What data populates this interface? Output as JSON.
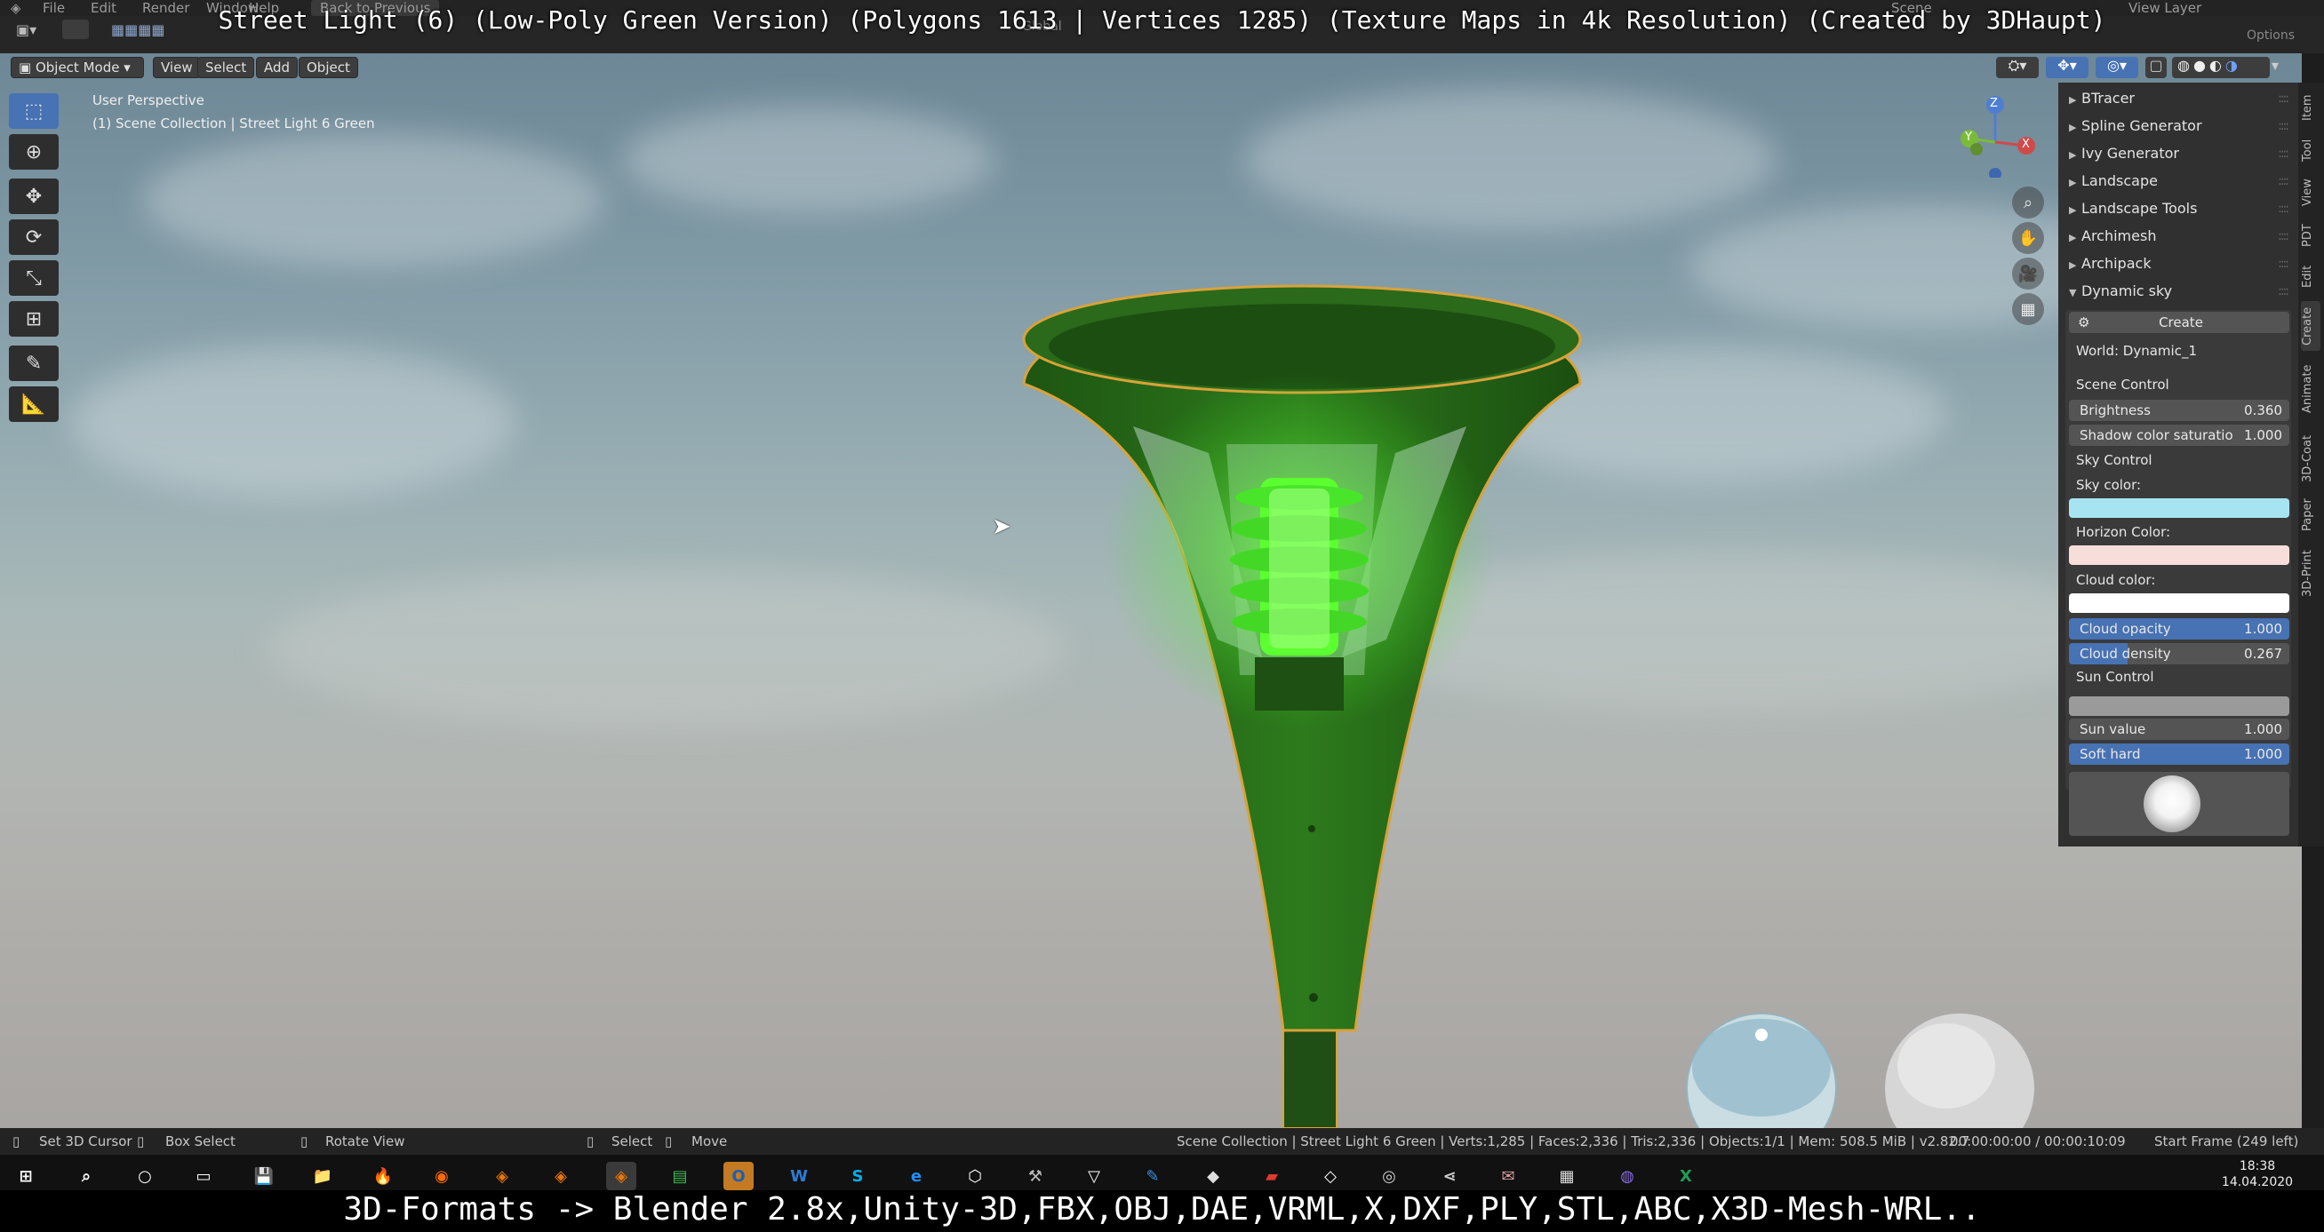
{
  "window": {
    "title_overlay": "Street Light (6) (Low-Poly Green Version) (Polygons 1613 | Vertices 1285) (Texture Maps in 4k Resolution) (Created by 3DHaupt)",
    "bottom_overlay": "3D-Formats -> Blender 2.8x,Unity-3D,FBX,OBJ,DAE,VRML,X,DXF,PLY,STL,ABC,X3D-Mesh-WRL.."
  },
  "topmenu": {
    "items": [
      "File",
      "Edit",
      "Render",
      "Window",
      "Help"
    ],
    "back_label": "Back to Previous",
    "scene_label": "Scene",
    "viewlayer_label": "View Layer",
    "options_label": "Options",
    "global_label": "Global"
  },
  "viewport_header": {
    "mode": "Object Mode",
    "menus": [
      "View",
      "Select",
      "Add",
      "Object"
    ]
  },
  "viewport": {
    "perspective": "User Perspective",
    "collection": "(1) Scene Collection | Street Light 6 Green"
  },
  "gizmo": {
    "axes": [
      "Z",
      "Y",
      "X"
    ]
  },
  "npanel": {
    "addons": [
      "BTracer",
      "Spline Generator",
      "Ivy Generator",
      "Landscape",
      "Landscape Tools",
      "Archimesh",
      "Archipack",
      "Dynamic sky"
    ],
    "create_label": "Create",
    "world_label": "World: Dynamic_1",
    "scene_control": "Scene Control",
    "brightness": {
      "label": "Brightness",
      "value": "0.360"
    },
    "shadow_sat": {
      "label": "Shadow color saturatio",
      "value": "1.000"
    },
    "sky_control": "Sky Control",
    "sky_color_label": "Sky color:",
    "horizon_color_label": "Horizon Color:",
    "cloud_color_label": "Cloud color:",
    "cloud_opacity": {
      "label": "Cloud opacity",
      "value": "1.000"
    },
    "cloud_density": {
      "label": "Cloud density",
      "value": "0.267"
    },
    "sun_control": "Sun Control",
    "sun_value": {
      "label": "Sun value",
      "value": "1.000"
    },
    "soft_hard": {
      "label": "Soft hard",
      "value": "1.000"
    },
    "colors": {
      "sky": "#a6e4f2",
      "horizon": "#f8dedb",
      "cloud": "#ffffff",
      "sun": "#9a9a9a"
    }
  },
  "vtabs": [
    "Item",
    "Tool",
    "View",
    "PDT",
    "Edit",
    "Create",
    "Animate",
    "3D-Coat",
    "Paper",
    "3D-Print"
  ],
  "statusbar": {
    "set_cursor": "Set 3D Cursor",
    "box_select": "Box Select",
    "rotate_view": "Rotate View",
    "select": "Select",
    "move": "Move",
    "stats": "Scene Collection | Street Light 6 Green | Verts:1,285 | Faces:2,336 | Tris:2,336 | Objects:1/1 | Mem: 508.5 MiB | v2.82.7",
    "timecode": "00:00:00:00 / 00:00:10:09",
    "start_frame": "Start Frame (249 left)"
  },
  "taskbar": {
    "time": "18:38",
    "date": "14.04.2020"
  }
}
